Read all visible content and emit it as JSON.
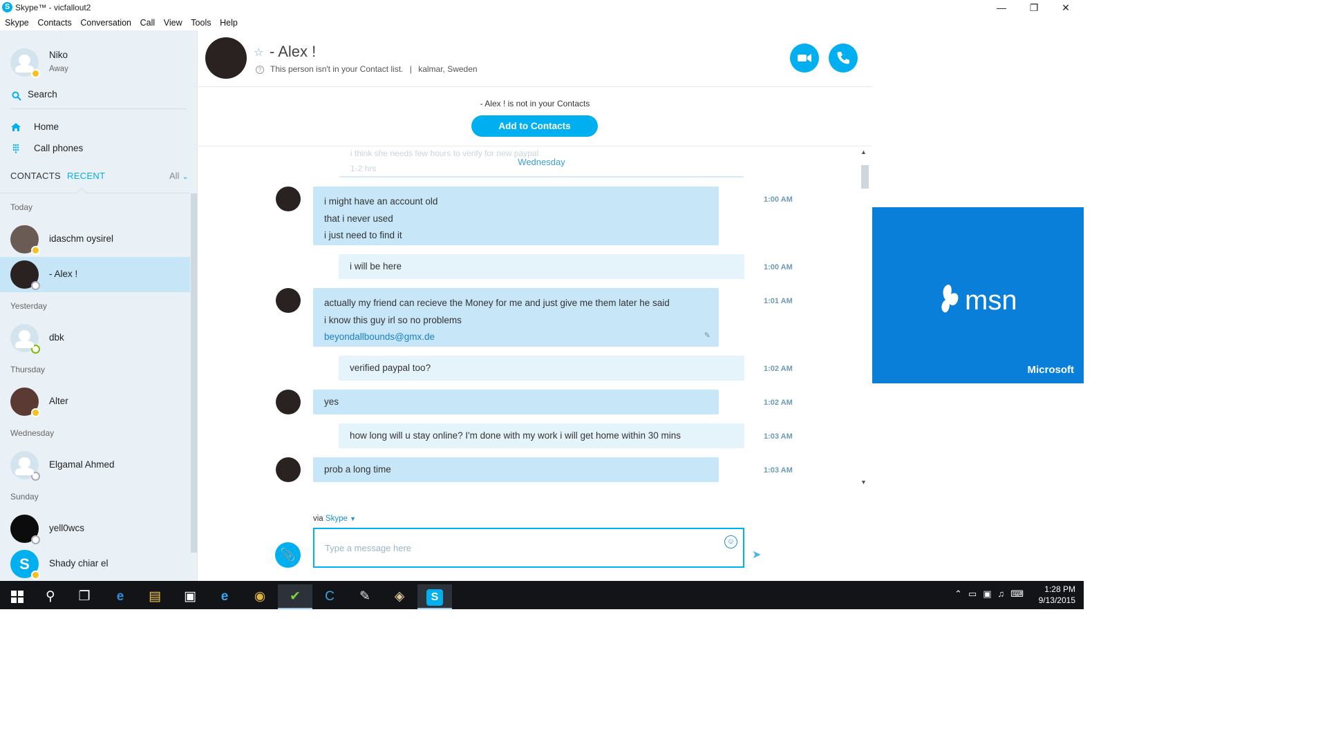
{
  "window": {
    "title": "Skype™ - vicfallout2"
  },
  "menu": [
    "Skype",
    "Contacts",
    "Conversation",
    "Call",
    "View",
    "Tools",
    "Help"
  ],
  "profile": {
    "name": "Niko",
    "status": "Away"
  },
  "search": {
    "label": "Search"
  },
  "nav": [
    {
      "label": "Home",
      "icon": "home-icon"
    },
    {
      "label": "Call phones",
      "icon": "dialpad-icon"
    }
  ],
  "tabs": {
    "contacts": "CONTACTS",
    "recent": "RECENT",
    "filter": "All"
  },
  "recent_groups": [
    {
      "header": "Today",
      "contacts": [
        {
          "name": "idaschm oysirel",
          "status": "away"
        },
        {
          "name": "- Alex !",
          "status": "unknown",
          "selected": true
        }
      ]
    },
    {
      "header": "Yesterday",
      "contacts": [
        {
          "name": "dbk",
          "status": "online"
        }
      ]
    },
    {
      "header": "Thursday",
      "contacts": [
        {
          "name": "Alter",
          "status": "away"
        }
      ]
    },
    {
      "header": "Wednesday",
      "contacts": [
        {
          "name": "Elgamal Ahmed",
          "status": "unknown"
        }
      ]
    },
    {
      "header": "Sunday",
      "contacts": [
        {
          "name": "yell0wcs",
          "status": "unknown"
        },
        {
          "name": "Shady chiar el",
          "status": "away"
        }
      ]
    }
  ],
  "conversation": {
    "name": "- Alex !",
    "subtitle": "This person isn't in your Contact list.",
    "location": "kalmar, Sweden",
    "banner_text": "- Alex ! is not in your Contacts",
    "add_button": "Add to Contacts",
    "ghost_text": [
      "i think she needs few hours to verify for new paypal",
      "1-2 hrs"
    ],
    "day_separator": "Wednesday",
    "messages": [
      {
        "dir": "in",
        "lines": [
          "i might have an account old",
          "that i never used",
          "i just need to find it"
        ],
        "time": "1:00 AM"
      },
      {
        "dir": "out",
        "lines": [
          "i will be here"
        ],
        "time": "1:00 AM"
      },
      {
        "dir": "in",
        "lines": [
          "actually my friend can recieve the Money for me and just give me them later he said",
          "i know this guy irl so no problems"
        ],
        "link": "beyondallbounds@gmx.de",
        "time": "1:01 AM"
      },
      {
        "dir": "out",
        "lines": [
          "verified paypal too?"
        ],
        "time": "1:02 AM"
      },
      {
        "dir": "in",
        "lines": [
          "yes"
        ],
        "time": "1:02 AM"
      },
      {
        "dir": "out",
        "lines": [
          "how long will u stay online? I'm done with my work i will get home within 30 mins"
        ],
        "time": "1:03 AM"
      },
      {
        "dir": "in",
        "lines": [
          "prob a long time"
        ],
        "time": "1:03 AM"
      }
    ]
  },
  "composer": {
    "via_label": "via",
    "via_service": "Skype",
    "placeholder": "Type a message here"
  },
  "ad": {
    "brand": "msn",
    "sponsor": "Microsoft",
    "color": "#0a7fd9"
  },
  "taskbar": {
    "apps": [
      "start-icon",
      "search-icon",
      "task-view-icon",
      "edge-icon",
      "file-explorer-icon",
      "store-icon",
      "ie-icon",
      "chrome-icon",
      "app-green-icon",
      "ccleaner-icon",
      "app-chart-icon",
      "paint-icon",
      "skype-icon"
    ],
    "time": "1:28 PM",
    "date": "9/13/2015"
  },
  "colors": {
    "accent": "#00aff0",
    "sidebar_bg": "#eaf1f6",
    "bubble_in": "#c7e7f8",
    "bubble_out": "#e5f3fb",
    "away": "#f8c018"
  }
}
